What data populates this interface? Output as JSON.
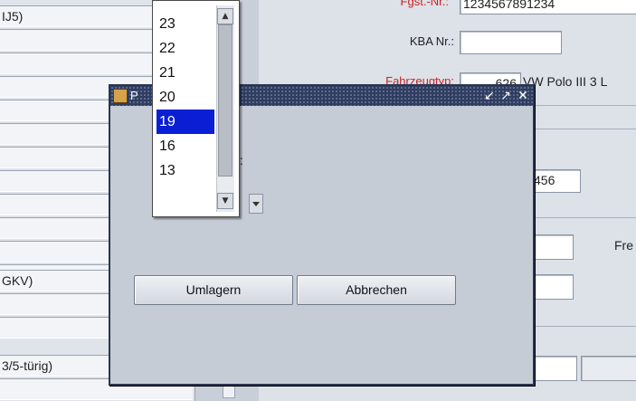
{
  "form": {
    "left_rows": [
      "IJ5)",
      "",
      "",
      "",
      "",
      "",
      "",
      "",
      "",
      "",
      "",
      "",
      "GKV)",
      "",
      "",
      "3/5-türig)",
      ""
    ],
    "fields": {
      "reg_label": "Fgst.-Nr.:",
      "reg_value": "1234567891234",
      "kba_label": "KBA Nr.:",
      "kba_value": "",
      "type_label": "Fahrzeugtyp:",
      "type_code": "626",
      "type_name": "VW Polo III 3 L",
      "number_value": "456",
      "fre_label": "Fre"
    },
    "colors": {
      "required_label": "#cc2222",
      "titlebar": "#2f3d61",
      "selection": "#0a1fd4"
    }
  },
  "dialog": {
    "title": "P",
    "colon": ":",
    "buttons": {
      "umlagern": "Umlagern",
      "abbrechen": "Abbrechen"
    },
    "titlebar_icons": [
      "minimize-icon",
      "maximize-icon",
      "close-icon"
    ]
  },
  "dropdown": {
    "items": [
      "23",
      "22",
      "21",
      "20",
      "19",
      "16",
      "13"
    ],
    "selected": "19"
  }
}
